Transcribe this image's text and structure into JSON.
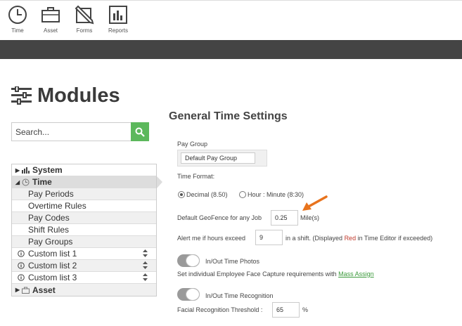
{
  "toolbar": {
    "items": [
      {
        "label": "Time",
        "icon": "clock-icon"
      },
      {
        "label": "Asset",
        "icon": "briefcase-icon"
      },
      {
        "label": "Forms",
        "icon": "edit-form-icon"
      },
      {
        "label": "Reports",
        "icon": "bar-chart-icon"
      }
    ]
  },
  "page": {
    "title": "Modules",
    "title_icon": "sliders-icon"
  },
  "search": {
    "placeholder": "Search...",
    "button_icon": "search-icon",
    "accent_color": "#5cb85c"
  },
  "tree": {
    "groups": [
      {
        "label": "System",
        "icon": "bar-chart-icon",
        "expanded": false
      },
      {
        "label": "Time",
        "icon": "clock-icon",
        "expanded": true,
        "active": true,
        "items": [
          "Pay Periods",
          "Overtime Rules",
          "Pay Codes",
          "Shift Rules",
          "Pay Groups"
        ]
      },
      {
        "label": "Asset",
        "icon": "briefcase-icon",
        "expanded": false
      }
    ],
    "custom_lists": [
      "Custom list 1",
      "Custom list 2",
      "Custom list 3"
    ]
  },
  "settings": {
    "title": "General Time Settings",
    "pay_group": {
      "label": "Pay Group",
      "value": "Default Pay Group"
    },
    "time_format": {
      "label": "Time Format:",
      "options": [
        "Decimal (8.50)",
        "Hour : Minute (8:30)"
      ],
      "selected": "Decimal (8.50)"
    },
    "geofence": {
      "label": "Default GeoFence for any Job",
      "value": "0.25",
      "unit": "Mile(s)"
    },
    "alert": {
      "prefix": "Alert me if hours exceed",
      "value": "9",
      "suffix_a": "in a shift. (Displayed",
      "suffix_red": "Red",
      "suffix_b": "in Time Editor if exceeded)"
    },
    "photos": {
      "toggle_label": "In/Out Time Photos",
      "note_prefix": "Set individual Employee Face Capture requirements with",
      "link": "Mass Assign"
    },
    "recognition": {
      "toggle_label": "In/Out Time Recognition",
      "threshold_label": "Facial Recognition Threshold :",
      "threshold_value": "65",
      "threshold_unit": "%"
    }
  },
  "colors": {
    "dark_bar": "#444444",
    "arrow": "#e8731d",
    "link": "#3c9a3c",
    "red_text": "#c0392b"
  }
}
